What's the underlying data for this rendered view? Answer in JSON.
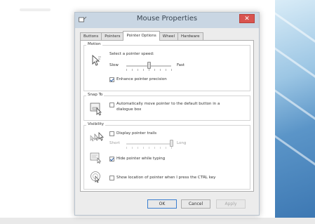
{
  "window": {
    "title": "Mouse Properties",
    "close_glyph": "✕"
  },
  "tabs": [
    {
      "label": "Buttons",
      "active": false
    },
    {
      "label": "Pointers",
      "active": false
    },
    {
      "label": "Pointer Options",
      "active": true
    },
    {
      "label": "Wheel",
      "active": false
    },
    {
      "label": "Hardware",
      "active": false
    }
  ],
  "motion": {
    "title": "Motion",
    "speed_label": "Select a pointer speed:",
    "slow": "Slow",
    "fast": "Fast",
    "speed_level": 0.5,
    "precision_label": "Enhance pointer precision",
    "precision_checked": true
  },
  "snap": {
    "title": "Snap To",
    "label_line1": "Automatically move pointer to the default button in a",
    "label_line2": "dialogue box",
    "checked": false
  },
  "visibility": {
    "title": "Visibility",
    "trails_label": "Display pointer trails",
    "trails_checked": false,
    "short": "Short",
    "long": "Long",
    "trails_level": 1.0,
    "hide_label": "Hide pointer while typing",
    "hide_checked": true,
    "ctrl_label": "Show location of pointer when I press the CTRL key",
    "ctrl_checked": false
  },
  "buttons": {
    "ok": "OK",
    "cancel": "Cancel",
    "apply": "Apply"
  },
  "icons": {
    "app": "mouse-icon",
    "motion": "pointer-speed-icon",
    "snap": "snap-to-icon",
    "trails": "pointer-trails-icon",
    "hide": "hide-pointer-icon",
    "ctrl": "pointer-location-icon"
  }
}
